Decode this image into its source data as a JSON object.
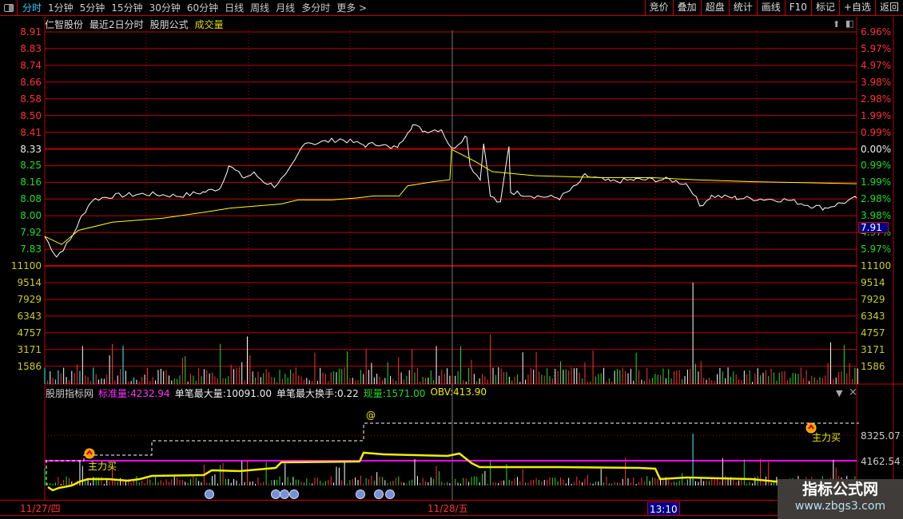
{
  "toolbar": {
    "periods": [
      "分时",
      "1分钟",
      "5分钟",
      "15分钟",
      "30分钟",
      "60分钟",
      "日线",
      "周线",
      "月线",
      "多分时",
      "更多 >"
    ],
    "active": 0,
    "buttons": [
      "竞价",
      "叠加",
      "超盘",
      "统计",
      "画线",
      "F10",
      "标记",
      "+自选",
      "返回"
    ]
  },
  "title": {
    "stock": "仁智股份",
    "mode": "最近2日分时",
    "formula": "股朋公式",
    "indicator": "成交量"
  },
  "price_axis": {
    "left": [
      "8.91",
      "8.83",
      "8.74",
      "8.66",
      "8.58",
      "8.50",
      "8.41",
      "8.33",
      "8.25",
      "8.16",
      "8.08",
      "8.00",
      "7.92",
      "7.83"
    ],
    "right": [
      "6.96%",
      "5.97%",
      "4.97%",
      "3.98%",
      "2.98%",
      "1.99%",
      "0.99%",
      "0.00%",
      "0.99%",
      "1.99%",
      "2.98%",
      "3.98%",
      "4.97%",
      "5.97%"
    ],
    "current_price_tag": "7.91"
  },
  "volume_axis": [
    "11100",
    "9514",
    "7929",
    "6343",
    "4757",
    "3171",
    "1586"
  ],
  "indicator": {
    "name": "股朋指标网",
    "std_label": "标准量:",
    "std_value": "4232.94",
    "max_label": "单笔最大量:",
    "max_value": "10091.00",
    "maxturn_label": "单笔最大换手:",
    "maxturn_value": "0.22",
    "cur_label": "现量:",
    "cur_value": "1571.00",
    "obv_label": "OBV:",
    "obv_value": "413.90",
    "levels": [
      "8325.07",
      "4162.54"
    ],
    "signal": "主力买",
    "at_mark": "@"
  },
  "dates": [
    "11/27/四",
    "11/28/五"
  ],
  "cursor_time": "13:10",
  "watermark": {
    "title": "指标公式网",
    "url": "www.zbgs3.com"
  },
  "colors": {
    "up": "#ff3333",
    "down": "#22dd22",
    "grid": "#c00000",
    "avg": "#ffff00",
    "price": "#ffffff"
  },
  "chart_data": {
    "type": "line",
    "preclose": 8.33,
    "minutes_total": 482,
    "price": [
      [
        0,
        7.9
      ],
      [
        7,
        7.8
      ],
      [
        15,
        7.88
      ],
      [
        22,
        8.0
      ],
      [
        28,
        8.08
      ],
      [
        40,
        8.1
      ],
      [
        60,
        8.11
      ],
      [
        80,
        8.1
      ],
      [
        95,
        8.12
      ],
      [
        104,
        8.14
      ],
      [
        109,
        8.25
      ],
      [
        118,
        8.19
      ],
      [
        124,
        8.21
      ],
      [
        130,
        8.17
      ],
      [
        136,
        8.15
      ],
      [
        143,
        8.2
      ],
      [
        148,
        8.27
      ],
      [
        154,
        8.37
      ],
      [
        160,
        8.36
      ],
      [
        175,
        8.38
      ],
      [
        190,
        8.35
      ],
      [
        200,
        8.36
      ],
      [
        205,
        8.33
      ],
      [
        210,
        8.35
      ],
      [
        215,
        8.42
      ],
      [
        218,
        8.45
      ],
      [
        225,
        8.42
      ],
      [
        235,
        8.43
      ],
      [
        250,
        8.4
      ],
      [
        260,
        8.37
      ],
      [
        275,
        8.35
      ],
      [
        241,
        8.33
      ],
      [
        241,
        8.33
      ],
      [
        252,
        8.25
      ],
      [
        258,
        8.18
      ],
      [
        264,
        8.1
      ],
      [
        270,
        8.06
      ],
      [
        276,
        8.12
      ],
      [
        290,
        8.1
      ],
      [
        305,
        8.09
      ],
      [
        315,
        8.15
      ],
      [
        320,
        8.2
      ],
      [
        335,
        8.17
      ],
      [
        350,
        8.18
      ],
      [
        370,
        8.18
      ],
      [
        380,
        8.16
      ],
      [
        384,
        8.12
      ],
      [
        388,
        8.05
      ],
      [
        395,
        8.1
      ],
      [
        410,
        8.09
      ],
      [
        440,
        8.08
      ],
      [
        455,
        8.05
      ],
      [
        462,
        8.04
      ],
      [
        470,
        8.06
      ],
      [
        478,
        8.08
      ],
      [
        481,
        8.09
      ]
    ],
    "avg": [
      [
        0,
        7.9
      ],
      [
        10,
        7.86
      ],
      [
        20,
        7.93
      ],
      [
        40,
        7.97
      ],
      [
        70,
        7.99
      ],
      [
        95,
        8.02
      ],
      [
        110,
        8.04
      ],
      [
        140,
        8.06
      ],
      [
        150,
        8.08
      ],
      [
        170,
        8.08
      ],
      [
        185,
        8.09
      ],
      [
        195,
        8.1
      ],
      [
        210,
        8.1
      ],
      [
        215,
        8.15
      ],
      [
        230,
        8.17
      ],
      [
        240,
        8.18
      ],
      [
        241,
        8.33
      ],
      [
        255,
        8.27
      ],
      [
        265,
        8.22
      ],
      [
        290,
        8.2
      ],
      [
        330,
        8.19
      ],
      [
        360,
        8.19
      ],
      [
        385,
        8.18
      ],
      [
        420,
        8.17
      ],
      [
        481,
        8.16
      ]
    ]
  }
}
